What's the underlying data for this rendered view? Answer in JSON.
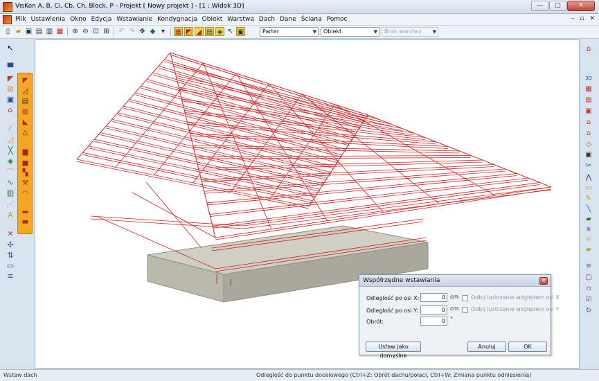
{
  "window": {
    "title": "VisKon A, B, Ci, Cb, Ch, Block, P - Projekt [ Nowy projekt ]  - [1 : Widok 3D]",
    "min": "—",
    "max": "▢",
    "close": "✕"
  },
  "menu": {
    "items": [
      "Plik",
      "Ustawienia",
      "Okno",
      "Edycja",
      "Wstawianie",
      "Kondygnacja",
      "Obiekt",
      "Warstwa",
      "Dach",
      "Dane",
      "Ściana",
      "Pomoc"
    ],
    "mdi_min": "–",
    "mdi_restore": "▫",
    "mdi_close": "✕"
  },
  "toolbar": {
    "floor_select": "Parter",
    "object_select": "Obiekt",
    "layer_select": "Brak warstwy"
  },
  "dialog": {
    "title": "Współrzędne wstawiania",
    "x_label": "Odległość po osi X:",
    "x_value": "0",
    "x_unit": "cm",
    "y_label": "Odległość po osi Y:",
    "y_value": "0",
    "y_unit": "cm",
    "rot_label": "Obrót:",
    "rot_value": "0",
    "rot_unit": "°",
    "mirror_x": "Odbij lustrzanie względem osi X",
    "mirror_y": "Odbij lustrzanie względem osi Y",
    "default_btn": "Ustaw jako domyślne",
    "cancel_btn": "Anuluj",
    "ok_btn": "OK"
  },
  "status": {
    "mode": "Wstaw dach",
    "hint": "Odległość do punktu docelowego (Ctrl+Z: Obrót dachu/połaci, Ctrl+W: Zmiana punktu odniesienia)"
  },
  "colors": {
    "roof_lines": "#cc2020",
    "slab_fill": "#c4c3b6",
    "accent_toolbar": "#f5a623"
  }
}
